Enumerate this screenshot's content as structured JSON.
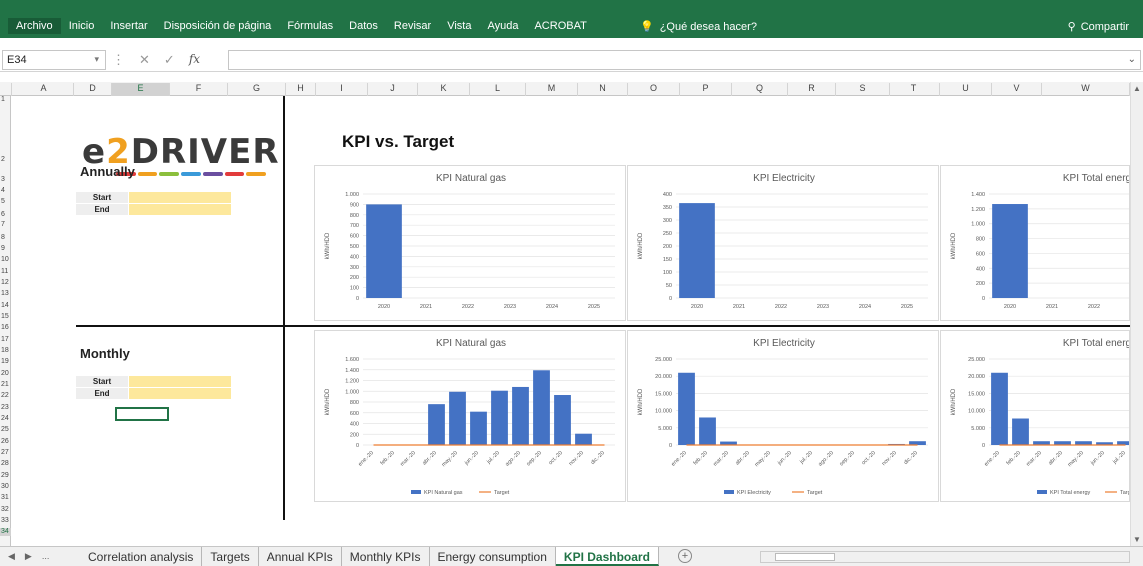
{
  "ribbon": {
    "tabs": [
      "Archivo",
      "Inicio",
      "Insertar",
      "Disposición de página",
      "Fórmulas",
      "Datos",
      "Revisar",
      "Vista",
      "Ayuda",
      "ACROBAT"
    ],
    "tell_me": "¿Qué desea hacer?",
    "share": "Compartir"
  },
  "formula_bar": {
    "name_box": "E34",
    "formula": ""
  },
  "columns": [
    "A",
    "D",
    "E",
    "F",
    "G",
    "H",
    "I",
    "J",
    "K",
    "L",
    "M",
    "N",
    "O",
    "P",
    "Q",
    "R",
    "S",
    "T",
    "U",
    "V",
    "W"
  ],
  "rows": [
    "1",
    "2",
    "3",
    "4",
    "5",
    "6",
    "7",
    "8",
    "9",
    "10",
    "11",
    "12",
    "13",
    "14",
    "15",
    "16",
    "17",
    "18",
    "19",
    "20",
    "21",
    "22",
    "23",
    "24",
    "25",
    "26",
    "27",
    "28",
    "29",
    "30",
    "31",
    "32",
    "33",
    "34"
  ],
  "logo": {
    "text_e": "e",
    "text_2": "2",
    "text_rest": "DRIVER"
  },
  "annually": {
    "title": "Annually",
    "start": "Start",
    "end": "End"
  },
  "monthly": {
    "title": "Monthly",
    "start": "Start",
    "end": "End"
  },
  "dashboard_title": "KPI vs. Target",
  "colors": {
    "bar": "#4472c4",
    "target": "#ed7d31",
    "excel_green": "#217346",
    "input_fill": "#fde89c"
  },
  "chart_data": [
    {
      "type": "bar",
      "title": "KPI Natural gas",
      "ylabel": "kWh/HDD",
      "categories": [
        "2020",
        "2021",
        "2022",
        "2023",
        "2024",
        "2025"
      ],
      "values": [
        900,
        0,
        0,
        0,
        0,
        0
      ],
      "ylim": [
        0,
        1000
      ],
      "yticks": [
        "0",
        "100",
        "200",
        "300",
        "400",
        "500",
        "600",
        "700",
        "800",
        "900",
        "1.000"
      ]
    },
    {
      "type": "bar",
      "title": "KPI Electricity",
      "ylabel": "kWh/HDD",
      "categories": [
        "2020",
        "2021",
        "2022",
        "2023",
        "2024",
        "2025"
      ],
      "values": [
        365,
        0,
        0,
        0,
        0,
        0
      ],
      "ylim": [
        0,
        400
      ],
      "yticks": [
        "0",
        "50",
        "100",
        "150",
        "200",
        "250",
        "300",
        "350",
        "400"
      ]
    },
    {
      "type": "bar",
      "title": "KPI Total energ",
      "ylabel": "kWh/HDD",
      "categories": [
        "2020",
        "2021",
        "2022"
      ],
      "values": [
        1265,
        0,
        0
      ],
      "ylim": [
        0,
        1400
      ],
      "yticks": [
        "0",
        "200",
        "400",
        "600",
        "800",
        "1.000",
        "1.200",
        "1.400"
      ]
    },
    {
      "type": "bar",
      "title": "KPI Natural gas",
      "ylabel": "kWh/HDD",
      "categories": [
        "ene.-20",
        "feb.-20",
        "mar.-20",
        "abr.-20",
        "may.-20",
        "jun.-20",
        "jul.-20",
        "ago.-20",
        "sep.-20",
        "oct.-20",
        "nov.-20",
        "dic.-20"
      ],
      "series": [
        {
          "name": "KPI Natural gas",
          "values": [
            0,
            0,
            0,
            760,
            990,
            620,
            1010,
            1080,
            1390,
            930,
            210,
            0
          ]
        },
        {
          "name": "Target",
          "values": [
            0,
            0,
            0,
            0,
            0,
            0,
            0,
            0,
            0,
            0,
            0,
            0
          ]
        }
      ],
      "ylim": [
        0,
        1600
      ],
      "yticks": [
        "0",
        "200",
        "400",
        "600",
        "800",
        "1.000",
        "1.200",
        "1.400",
        "1.600"
      ]
    },
    {
      "type": "bar",
      "title": "KPI Electricity",
      "ylabel": "kWh/HDD",
      "categories": [
        "ene.-20",
        "feb.-20",
        "mar.-20",
        "abr.-20",
        "may.-20",
        "jun.-20",
        "jul.-20",
        "ago.-20",
        "sep.-20",
        "oct.-20",
        "nov.-20",
        "dic.-20"
      ],
      "series": [
        {
          "name": "KPI Electricity",
          "values": [
            21000,
            8000,
            1000,
            100,
            100,
            100,
            100,
            100,
            100,
            100,
            300,
            1100
          ]
        },
        {
          "name": "Target",
          "values": [
            0,
            0,
            0,
            0,
            0,
            0,
            0,
            0,
            0,
            0,
            0,
            0
          ]
        }
      ],
      "ylim": [
        0,
        25000
      ],
      "yticks": [
        "0",
        "5.000",
        "10.000",
        "15.000",
        "20.000",
        "25.000"
      ]
    },
    {
      "type": "bar",
      "title": "KPI Total energ",
      "ylabel": "kWh/HDD",
      "categories": [
        "ene.-20",
        "feb.-20",
        "mar.-20",
        "abr.-20",
        "may.-20",
        "jun.-20",
        "jul.-20"
      ],
      "series": [
        {
          "name": "KPI Total energy",
          "values": [
            21000,
            7700,
            1100,
            1100,
            1100,
            800,
            1100
          ]
        },
        {
          "name": "Target",
          "values": [
            0,
            0,
            0,
            0,
            0,
            0,
            0
          ]
        }
      ],
      "ylim": [
        0,
        25000
      ],
      "yticks": [
        "0",
        "5.000",
        "10.000",
        "15.000",
        "20.000",
        "25.000"
      ]
    }
  ],
  "sheet_tabs": [
    "Correlation analysis",
    "Targets",
    "Annual KPIs",
    "Monthly KPIs",
    "Energy consumption",
    "KPI Dashboard"
  ],
  "active_tab": "KPI Dashboard",
  "nav_ellipsis": "..."
}
